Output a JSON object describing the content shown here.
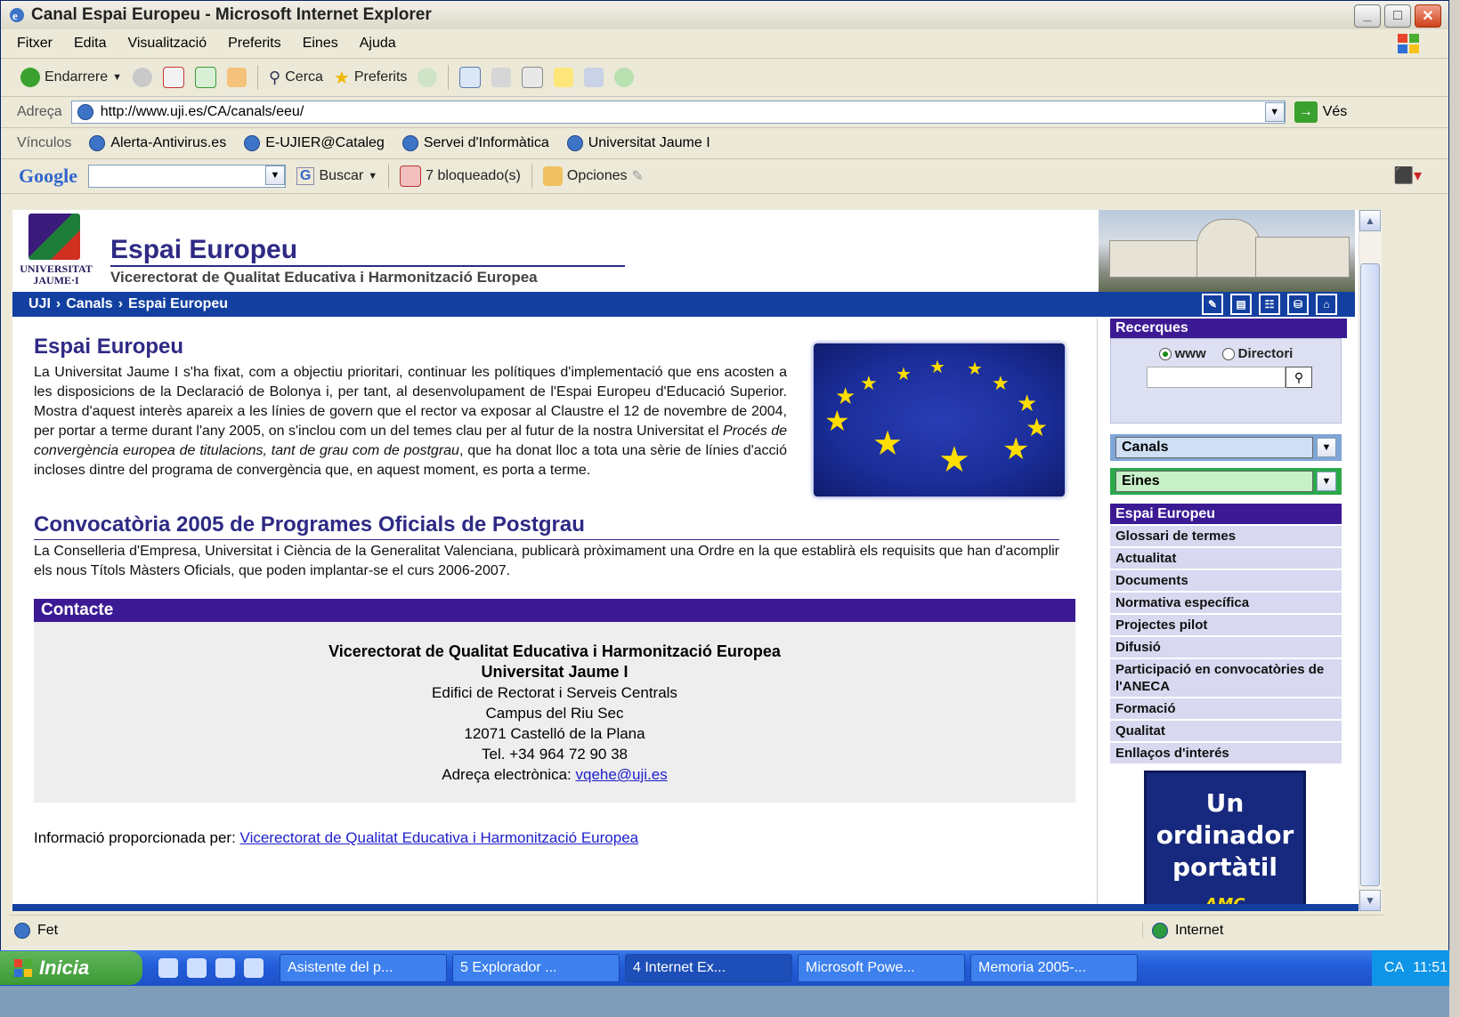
{
  "window": {
    "title": "Canal Espai Europeu - Microsoft Internet Explorer"
  },
  "menubar": {
    "items": [
      "Fitxer",
      "Edita",
      "Visualització",
      "Preferits",
      "Eines",
      "Ajuda"
    ]
  },
  "toolbar": {
    "back_label": "Endarrere",
    "search_label": "Cerca",
    "favorites_label": "Preferits"
  },
  "address": {
    "label": "Adreça",
    "url": "http://www.uji.es/CA/canals/eeu/",
    "go_label": "Vés"
  },
  "links": {
    "label": "Vínculos",
    "items": [
      "Alerta-Antivirus.es",
      "E-UJIER@Cataleg",
      "Servei d'Informàtica",
      "Universitat Jaume I"
    ]
  },
  "google": {
    "logo": "Google",
    "search_label": "Buscar",
    "blocked_label": "7 bloqueado(s)",
    "options_label": "Opciones"
  },
  "site": {
    "logo_text_1": "UNIVERSITAT",
    "logo_text_2": "JAUME·I",
    "title": "Espai Europeu",
    "subtitle": "Vicerectorat de Qualitat Educativa i Harmonització Europea",
    "breadcrumb": [
      "UJI",
      "Canals",
      "Espai Europeu"
    ]
  },
  "main": {
    "section1_title": "Espai Europeu",
    "section1_text_a": "La Universitat Jaume I s'ha fixat, com a objectiu prioritari, continuar les polítiques d'implementació que ens acosten a les disposicions de la Declaració de Bolonya i, per tant, al desenvolupament de l'Espai Europeu d'Educació Superior. Mostra d'aquest interès apareix a les línies de govern que el rector va exposar al Claustre el 12 de novembre de 2004, per portar a terme durant l'any 2005, on s'inclou com un del temes clau per al futur de la nostra Universitat el ",
    "section1_text_em": "Procés de convergència europea de titulacions, tant de grau com de postgrau",
    "section1_text_b": ", que ha donat lloc a tota una sèrie de línies d'acció incloses dintre del programa de convergència que, en aquest moment, es porta a terme.",
    "section2_title": "Convocatòria 2005 de Programes Oficials de Postgrau",
    "section2_text": "La Conselleria d'Empresa, Universitat i Ciència de la Generalitat Valenciana, publicarà pròximament una Ordre en la que establirà els requisits que han d'acomplir els nous Títols Màsters Oficials, que poden implantar-se el curs 2006-2007.",
    "contact_title": "Contacte",
    "contact": {
      "line1": "Vicerectorat de Qualitat Educativa i Harmonització Europea",
      "line2": "Universitat Jaume I",
      "line3": "Edifici de Rectorat i Serveis Centrals",
      "line4": "Campus del Riu Sec",
      "line5": "12071 Castelló de la Plana",
      "line6": "Tel. +34 964 72 90 38",
      "email_label": "Adreça electrònica: ",
      "email": "vqehe@uji.es"
    },
    "info_label": "Informació proporcionada per: ",
    "info_link": "Vicerectorat de Qualitat Educativa i Harmonització Europea"
  },
  "sidebar": {
    "search_title": "Recerques",
    "radio_www": "www",
    "radio_dir": "Directori",
    "canals": "Canals",
    "eines": "Eines",
    "menu_title": "Espai Europeu",
    "menu": [
      "Glossari de termes",
      "Actualitat",
      "Documents",
      "Normativa específica",
      "Projectes pilot",
      "Difusió",
      "Participació en convocatòries de l'ANECA",
      "Formació",
      "Qualitat",
      "Enllaços d'interés"
    ],
    "ad_line1": "Un",
    "ad_line2": "ordinador",
    "ad_line3": "portàtil",
    "ad_brand": "AMC"
  },
  "status": {
    "text": "Fet",
    "zone": "Internet"
  },
  "taskbar": {
    "start": "Inicia",
    "tasks": [
      "Asistente del p...",
      "5 Explorador ...",
      "4 Internet Ex...",
      "Microsoft Powe...",
      "Memoria 2005-..."
    ],
    "lang": "CA",
    "clock": "11:51"
  },
  "colors": {
    "accent": "#3c1a94",
    "nav": "#1340a0",
    "title": "#2e2a84"
  }
}
